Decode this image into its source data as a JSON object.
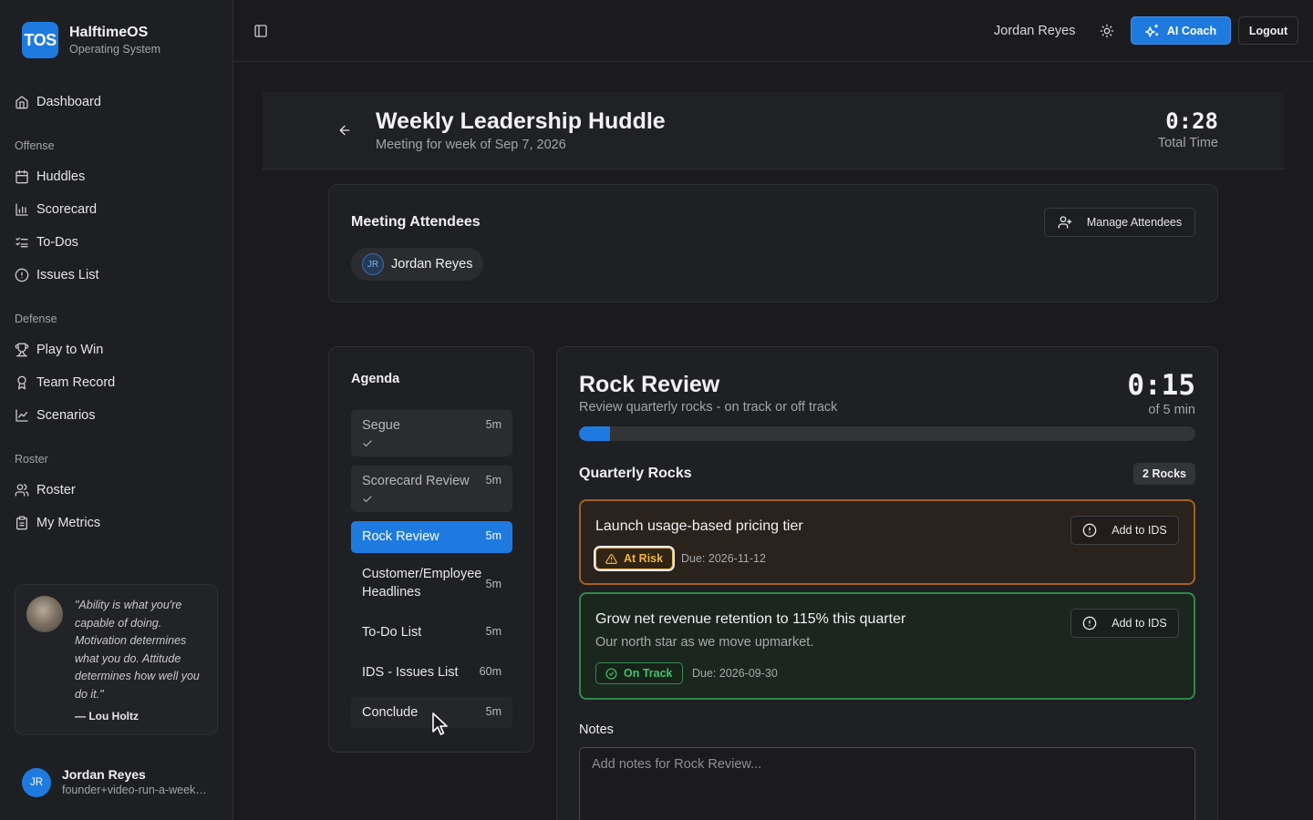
{
  "brand": {
    "logo": "TOS",
    "name": "HalftimeOS",
    "subtitle": "Operating System"
  },
  "sidebar": {
    "dashboard": {
      "label": "Dashboard",
      "icon": "home-icon"
    },
    "sections": [
      {
        "title": "Offense",
        "items": [
          {
            "label": "Huddles",
            "icon": "calendar-icon"
          },
          {
            "label": "Scorecard",
            "icon": "bar-chart-icon"
          },
          {
            "label": "To-Dos",
            "icon": "list-checks-icon"
          },
          {
            "label": "Issues List",
            "icon": "alert-circle-icon"
          }
        ]
      },
      {
        "title": "Defense",
        "items": [
          {
            "label": "Play to Win",
            "icon": "trophy-icon"
          },
          {
            "label": "Team Record",
            "icon": "award-icon"
          },
          {
            "label": "Scenarios",
            "icon": "line-chart-icon"
          }
        ]
      },
      {
        "title": "Roster",
        "items": [
          {
            "label": "Roster",
            "icon": "users-icon"
          },
          {
            "label": "My Metrics",
            "icon": "clipboard-icon"
          }
        ]
      }
    ],
    "quote": {
      "text": "\"Ability is what you're capable of doing. Motivation determines what you do. Attitude determines how well you do it.\"",
      "author": "— Lou Holtz"
    },
    "user": {
      "initials": "JR",
      "name": "Jordan Reyes",
      "email": "founder+video-run-a-weekly-huddle@halftimeos.com"
    }
  },
  "topbar": {
    "user_name": "Jordan Reyes",
    "ai_coach_label": "AI Coach",
    "logout_label": "Logout"
  },
  "meeting": {
    "title": "Weekly Leadership Huddle",
    "subtitle": "Meeting for week of Sep 7, 2026",
    "total_time": "0:28",
    "total_time_label": "Total Time"
  },
  "attendees": {
    "title": "Meeting Attendees",
    "manage_label": "Manage Attendees",
    "list": [
      {
        "initials": "JR",
        "name": "Jordan Reyes"
      }
    ]
  },
  "agenda": {
    "title": "Agenda",
    "items": [
      {
        "label": "Segue",
        "duration": "5m",
        "state": "done"
      },
      {
        "label": "Scorecard Review",
        "duration": "5m",
        "state": "done"
      },
      {
        "label": "Rock Review",
        "duration": "5m",
        "state": "active"
      },
      {
        "label": "Customer/Employee Headlines",
        "duration": "5m",
        "state": "pending"
      },
      {
        "label": "To-Do List",
        "duration": "5m",
        "state": "pending"
      },
      {
        "label": "IDS - Issues List",
        "duration": "60m",
        "state": "pending"
      },
      {
        "label": "Conclude",
        "duration": "5m",
        "state": "pending"
      }
    ]
  },
  "section": {
    "title": "Rock Review",
    "description": "Review quarterly rocks - on track or off track",
    "timer": "0:15",
    "timer_label": "of 5 min",
    "progress_fraction": 0.05,
    "rocks_title": "Quarterly Rocks",
    "rocks_badge": "2 Rocks",
    "rocks": [
      {
        "title": "Launch usage-based pricing tier",
        "description": "",
        "status": "At Risk",
        "due": "Due: 2026-11-12",
        "ids_label": "Add to IDS"
      },
      {
        "title": "Grow net revenue retention to 115% this quarter",
        "description": "Our north star as we move upmarket.",
        "status": "On Track",
        "due": "Due: 2026-09-30",
        "ids_label": "Add to IDS"
      }
    ],
    "notes_label": "Notes",
    "notes_placeholder": "Add notes for Rock Review..."
  },
  "colors": {
    "accent": "#1f7ae0",
    "at_risk": "#f2b33d",
    "on_track": "#3fc26b",
    "background": "#1b1b1e"
  }
}
